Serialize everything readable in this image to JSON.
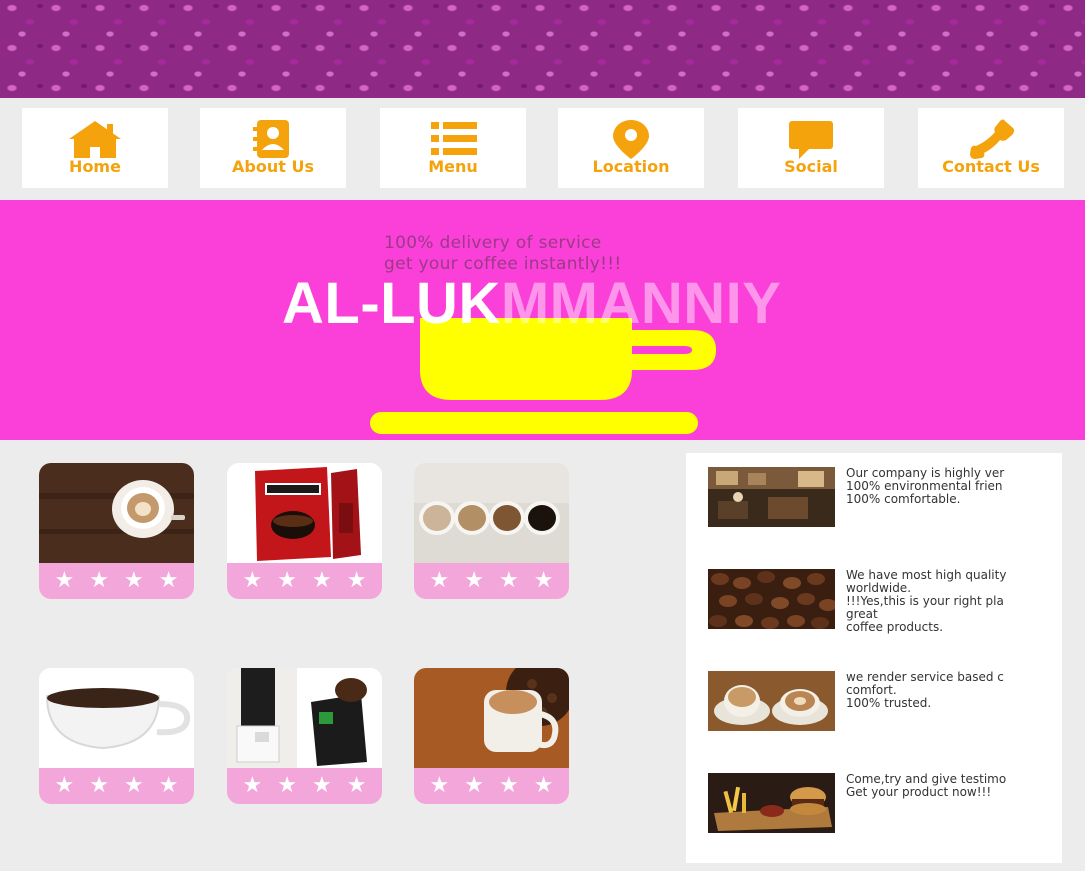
{
  "nav": {
    "items": [
      {
        "label": "Home",
        "icon": "home-icon"
      },
      {
        "label": "About Us",
        "icon": "contact-book-icon"
      },
      {
        "label": "Menu",
        "icon": "list-icon"
      },
      {
        "label": "Location",
        "icon": "map-pin-icon"
      },
      {
        "label": "Social",
        "icon": "chat-bubble-icon"
      },
      {
        "label": "Contact Us",
        "icon": "phone-icon"
      }
    ]
  },
  "hero": {
    "tagline_line1": "100% delivery of service",
    "tagline_line2": "get your coffee instantly!!!",
    "brand_bold": "AL-LUK",
    "brand_faded": "MMANNIY",
    "cup_icon": "coffee-cup-icon"
  },
  "products": [
    {
      "image": "latte-art-cup-on-wood",
      "rating": 4
    },
    {
      "image": "nescafe-coffee-pack",
      "rating": 4
    },
    {
      "image": "four-coffee-cups",
      "rating": 4
    },
    {
      "image": "black-coffee-cup",
      "rating": 4
    },
    {
      "image": "coffee-press-and-grinder",
      "rating": 4
    },
    {
      "image": "cup-on-coffee-beans",
      "rating": 4
    }
  ],
  "sidebar": {
    "items": [
      {
        "image": "cafe-interior",
        "text": "Our company is highly ver\n100% environmental frien\n100% comfortable."
      },
      {
        "image": "coffee-beans",
        "text": "We have most high quality\nworldwide.\n!!!Yes,this is your right pla\ngreat\ncoffee products."
      },
      {
        "image": "two-coffee-cups",
        "text": "we render service based c\ncomfort.\n100% trusted."
      },
      {
        "image": "food-platter",
        "text": "Come,try and give testimo\nGet your product now!!!"
      }
    ]
  },
  "colors": {
    "accent_orange": "#f4a30d",
    "hero_pink": "#fb3fd9",
    "cup_yellow": "#ffff00",
    "star_bar_pink": "#f2a6d9"
  }
}
